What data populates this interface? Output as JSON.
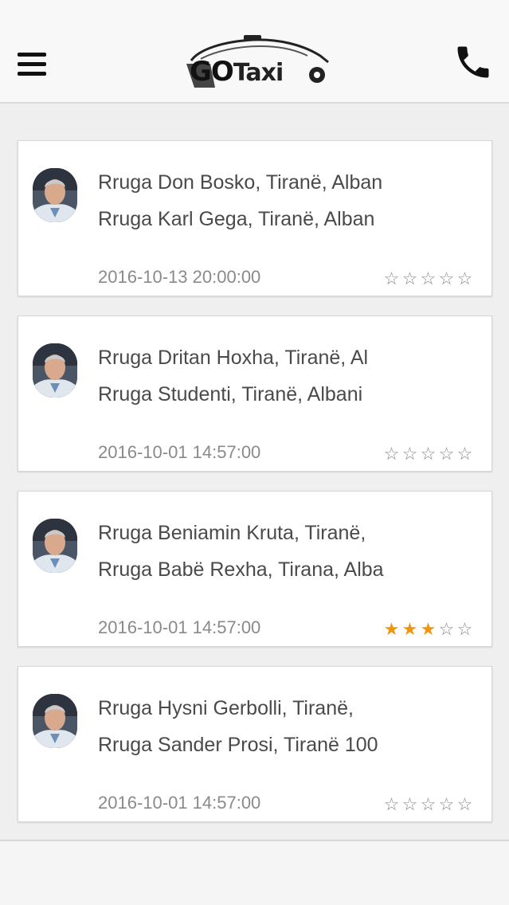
{
  "header": {
    "logo_text_go": "GO",
    "logo_text_taxi": "Taxi",
    "menu_icon": "hamburger-menu-icon",
    "call_icon": "phone-icon"
  },
  "colors": {
    "star_filled": "#f0960e",
    "star_empty": "#8c8c8c",
    "background": "#efefef"
  },
  "rides": [
    {
      "from": "Rruga Don Bosko, Tiranë, Alban",
      "to": "Rruga Karl Gega, Tiranë, Alban",
      "date": "2016-10-13 20:00:00",
      "rating": 0,
      "max_rating": 5
    },
    {
      "from": "Rruga Dritan Hoxha, Tiranë, Al",
      "to": "Rruga Studenti, Tiranë, Albani",
      "date": "2016-10-01 14:57:00",
      "rating": 0,
      "max_rating": 5
    },
    {
      "from": "Rruga Beniamin Kruta, Tiranë,",
      "to": "Rruga Babë Rexha, Tirana, Alba",
      "date": "2016-10-01 14:57:00",
      "rating": 3,
      "max_rating": 5
    },
    {
      "from": "Rruga Hysni Gerbolli, Tiranë,",
      "to": "Rruga Sander Prosi, Tiranë 100",
      "date": "2016-10-01 14:57:00",
      "rating": 0,
      "max_rating": 5
    }
  ]
}
